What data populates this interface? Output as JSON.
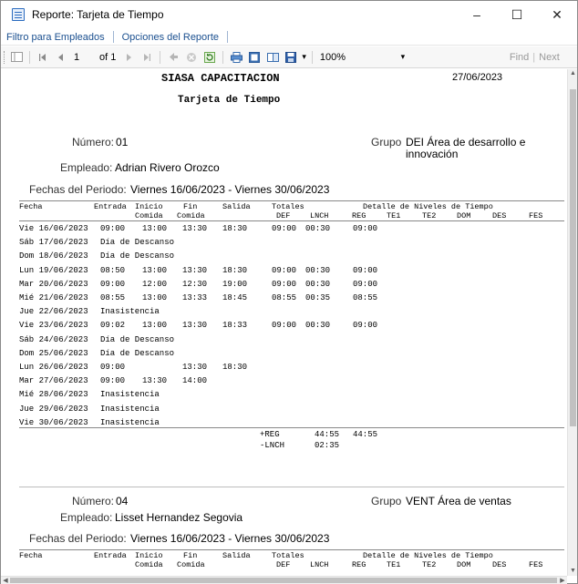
{
  "window": {
    "title": "Reporte: Tarjeta de Tiempo",
    "minimize": "–",
    "maximize": "☐",
    "close": "✕"
  },
  "menu": {
    "items": [
      "Filtro para Empleados",
      "Opciones del Reporte"
    ]
  },
  "toolbar": {
    "page_current": "1",
    "page_of": "of 1",
    "zoom": "100%",
    "zoom_dropdown": "▾",
    "find": "Find",
    "separator": "|",
    "next": "Next"
  },
  "report": {
    "company": "SIASA CAPACITACION",
    "date": "27/06/2023",
    "title": "Tarjeta de Tiempo",
    "columns": {
      "fecha": "Fecha",
      "entrada": "Entrada",
      "inicio": "Inicio",
      "comida": "Comida",
      "fin": "Fin",
      "comida2": "Comida",
      "salida": "Salida",
      "totales": "Totales",
      "def": "DEF",
      "lnch": "LNCH",
      "detalle": "Detalle de Niveles de Tiempo",
      "reg": "REG",
      "te1": "TE1",
      "te2": "TE2",
      "dom": "DOM",
      "des": "DES",
      "fes": "FES"
    },
    "labels": {
      "numero": "Número:",
      "grupo": "Grupo",
      "empleado": "Empleado:",
      "periodo": "Fechas del Periodo:"
    },
    "employees": [
      {
        "numero": "01",
        "grupo": "DEI Área de desarrollo e",
        "grupo_line2": "innovación",
        "empleado": "Adrian Rivero Orozco",
        "periodo": "Viernes 16/06/2023 - Viernes 30/06/2023",
        "rows": [
          {
            "fecha": "Vie 16/06/2023",
            "entrada": "09:00",
            "inicio": "13:00",
            "fin": "13:30",
            "salida": "18:30",
            "def": "09:00",
            "lnch": "00:30",
            "reg": "09:00"
          },
          {
            "fecha": "Sáb 17/06/2023",
            "entrada": "Día de Descanso",
            "inicio": "",
            "fin": "",
            "salida": "",
            "def": "",
            "lnch": "",
            "reg": ""
          },
          {
            "fecha": "Dom 18/06/2023",
            "entrada": "Día de Descanso",
            "inicio": "",
            "fin": "",
            "salida": "",
            "def": "",
            "lnch": "",
            "reg": ""
          },
          {
            "fecha": "Lun 19/06/2023",
            "entrada": "08:50",
            "inicio": "13:00",
            "fin": "13:30",
            "salida": "18:30",
            "def": "09:00",
            "lnch": "00:30",
            "reg": "09:00"
          },
          {
            "fecha": "Mar 20/06/2023",
            "entrada": "09:00",
            "inicio": "12:00",
            "fin": "12:30",
            "salida": "19:00",
            "def": "09:00",
            "lnch": "00:30",
            "reg": "09:00"
          },
          {
            "fecha": "Mié 21/06/2023",
            "entrada": "08:55",
            "inicio": "13:00",
            "fin": "13:33",
            "salida": "18:45",
            "def": "08:55",
            "lnch": "00:35",
            "reg": "08:55"
          },
          {
            "fecha": "Jue 22/06/2023",
            "entrada": "Inasistencia",
            "inicio": "",
            "fin": "",
            "salida": "",
            "def": "",
            "lnch": "",
            "reg": ""
          },
          {
            "fecha": "Vie 23/06/2023",
            "entrada": "09:02",
            "inicio": "13:00",
            "fin": "13:30",
            "salida": "18:33",
            "def": "09:00",
            "lnch": "00:30",
            "reg": "09:00"
          },
          {
            "fecha": "Sáb 24/06/2023",
            "entrada": "Día de Descanso",
            "inicio": "",
            "fin": "",
            "salida": "",
            "def": "",
            "lnch": "",
            "reg": ""
          },
          {
            "fecha": "Dom 25/06/2023",
            "entrada": "Día de Descanso",
            "inicio": "",
            "fin": "",
            "salida": "",
            "def": "",
            "lnch": "",
            "reg": ""
          },
          {
            "fecha": "Lun 26/06/2023",
            "entrada": "09:00",
            "inicio": "",
            "fin": "13:30",
            "salida": "18:30",
            "def": "",
            "lnch": "",
            "reg": ""
          },
          {
            "fecha": "Mar 27/06/2023",
            "entrada": "09:00",
            "inicio": "13:30",
            "fin": "14:00",
            "salida": "",
            "def": "",
            "lnch": "",
            "reg": ""
          },
          {
            "fecha": "Mié 28/06/2023",
            "entrada": "Inasistencia",
            "inicio": "",
            "fin": "",
            "salida": "",
            "def": "",
            "lnch": "",
            "reg": ""
          },
          {
            "fecha": "Jue 29/06/2023",
            "entrada": "Inasistencia",
            "inicio": "",
            "fin": "",
            "salida": "",
            "def": "",
            "lnch": "",
            "reg": ""
          },
          {
            "fecha": "Vie 30/06/2023",
            "entrada": "Inasistencia",
            "inicio": "",
            "fin": "",
            "salida": "",
            "def": "",
            "lnch": "",
            "reg": ""
          }
        ],
        "summary": {
          "reg_label": "+REG",
          "reg_total": "44:55",
          "reg_detail": "44:55",
          "lnch_label": "-LNCH",
          "lnch_total": "02:35"
        }
      },
      {
        "numero": "04",
        "grupo": "VENT Área de ventas",
        "empleado": "Lisset Hernandez Segovia",
        "periodo": "Viernes 16/06/2023 - Viernes 30/06/2023"
      }
    ]
  }
}
